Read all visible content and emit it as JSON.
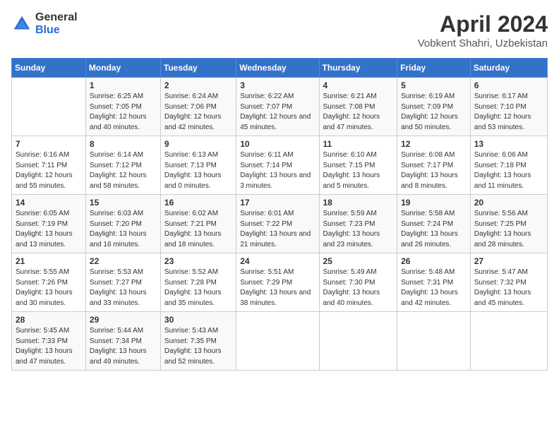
{
  "logo": {
    "general": "General",
    "blue": "Blue"
  },
  "title": "April 2024",
  "location": "Vobkent Shahri, Uzbekistan",
  "weekdays": [
    "Sunday",
    "Monday",
    "Tuesday",
    "Wednesday",
    "Thursday",
    "Friday",
    "Saturday"
  ],
  "weeks": [
    [
      {
        "day": "",
        "sunrise": "",
        "sunset": "",
        "daylight": ""
      },
      {
        "day": "1",
        "sunrise": "Sunrise: 6:25 AM",
        "sunset": "Sunset: 7:05 PM",
        "daylight": "Daylight: 12 hours and 40 minutes."
      },
      {
        "day": "2",
        "sunrise": "Sunrise: 6:24 AM",
        "sunset": "Sunset: 7:06 PM",
        "daylight": "Daylight: 12 hours and 42 minutes."
      },
      {
        "day": "3",
        "sunrise": "Sunrise: 6:22 AM",
        "sunset": "Sunset: 7:07 PM",
        "daylight": "Daylight: 12 hours and 45 minutes."
      },
      {
        "day": "4",
        "sunrise": "Sunrise: 6:21 AM",
        "sunset": "Sunset: 7:08 PM",
        "daylight": "Daylight: 12 hours and 47 minutes."
      },
      {
        "day": "5",
        "sunrise": "Sunrise: 6:19 AM",
        "sunset": "Sunset: 7:09 PM",
        "daylight": "Daylight: 12 hours and 50 minutes."
      },
      {
        "day": "6",
        "sunrise": "Sunrise: 6:17 AM",
        "sunset": "Sunset: 7:10 PM",
        "daylight": "Daylight: 12 hours and 53 minutes."
      }
    ],
    [
      {
        "day": "7",
        "sunrise": "Sunrise: 6:16 AM",
        "sunset": "Sunset: 7:11 PM",
        "daylight": "Daylight: 12 hours and 55 minutes."
      },
      {
        "day": "8",
        "sunrise": "Sunrise: 6:14 AM",
        "sunset": "Sunset: 7:12 PM",
        "daylight": "Daylight: 12 hours and 58 minutes."
      },
      {
        "day": "9",
        "sunrise": "Sunrise: 6:13 AM",
        "sunset": "Sunset: 7:13 PM",
        "daylight": "Daylight: 13 hours and 0 minutes."
      },
      {
        "day": "10",
        "sunrise": "Sunrise: 6:11 AM",
        "sunset": "Sunset: 7:14 PM",
        "daylight": "Daylight: 13 hours and 3 minutes."
      },
      {
        "day": "11",
        "sunrise": "Sunrise: 6:10 AM",
        "sunset": "Sunset: 7:15 PM",
        "daylight": "Daylight: 13 hours and 5 minutes."
      },
      {
        "day": "12",
        "sunrise": "Sunrise: 6:08 AM",
        "sunset": "Sunset: 7:17 PM",
        "daylight": "Daylight: 13 hours and 8 minutes."
      },
      {
        "day": "13",
        "sunrise": "Sunrise: 6:06 AM",
        "sunset": "Sunset: 7:18 PM",
        "daylight": "Daylight: 13 hours and 11 minutes."
      }
    ],
    [
      {
        "day": "14",
        "sunrise": "Sunrise: 6:05 AM",
        "sunset": "Sunset: 7:19 PM",
        "daylight": "Daylight: 13 hours and 13 minutes."
      },
      {
        "day": "15",
        "sunrise": "Sunrise: 6:03 AM",
        "sunset": "Sunset: 7:20 PM",
        "daylight": "Daylight: 13 hours and 16 minutes."
      },
      {
        "day": "16",
        "sunrise": "Sunrise: 6:02 AM",
        "sunset": "Sunset: 7:21 PM",
        "daylight": "Daylight: 13 hours and 18 minutes."
      },
      {
        "day": "17",
        "sunrise": "Sunrise: 6:01 AM",
        "sunset": "Sunset: 7:22 PM",
        "daylight": "Daylight: 13 hours and 21 minutes."
      },
      {
        "day": "18",
        "sunrise": "Sunrise: 5:59 AM",
        "sunset": "Sunset: 7:23 PM",
        "daylight": "Daylight: 13 hours and 23 minutes."
      },
      {
        "day": "19",
        "sunrise": "Sunrise: 5:58 AM",
        "sunset": "Sunset: 7:24 PM",
        "daylight": "Daylight: 13 hours and 26 minutes."
      },
      {
        "day": "20",
        "sunrise": "Sunrise: 5:56 AM",
        "sunset": "Sunset: 7:25 PM",
        "daylight": "Daylight: 13 hours and 28 minutes."
      }
    ],
    [
      {
        "day": "21",
        "sunrise": "Sunrise: 5:55 AM",
        "sunset": "Sunset: 7:26 PM",
        "daylight": "Daylight: 13 hours and 30 minutes."
      },
      {
        "day": "22",
        "sunrise": "Sunrise: 5:53 AM",
        "sunset": "Sunset: 7:27 PM",
        "daylight": "Daylight: 13 hours and 33 minutes."
      },
      {
        "day": "23",
        "sunrise": "Sunrise: 5:52 AM",
        "sunset": "Sunset: 7:28 PM",
        "daylight": "Daylight: 13 hours and 35 minutes."
      },
      {
        "day": "24",
        "sunrise": "Sunrise: 5:51 AM",
        "sunset": "Sunset: 7:29 PM",
        "daylight": "Daylight: 13 hours and 38 minutes."
      },
      {
        "day": "25",
        "sunrise": "Sunrise: 5:49 AM",
        "sunset": "Sunset: 7:30 PM",
        "daylight": "Daylight: 13 hours and 40 minutes."
      },
      {
        "day": "26",
        "sunrise": "Sunrise: 5:48 AM",
        "sunset": "Sunset: 7:31 PM",
        "daylight": "Daylight: 13 hours and 42 minutes."
      },
      {
        "day": "27",
        "sunrise": "Sunrise: 5:47 AM",
        "sunset": "Sunset: 7:32 PM",
        "daylight": "Daylight: 13 hours and 45 minutes."
      }
    ],
    [
      {
        "day": "28",
        "sunrise": "Sunrise: 5:45 AM",
        "sunset": "Sunset: 7:33 PM",
        "daylight": "Daylight: 13 hours and 47 minutes."
      },
      {
        "day": "29",
        "sunrise": "Sunrise: 5:44 AM",
        "sunset": "Sunset: 7:34 PM",
        "daylight": "Daylight: 13 hours and 49 minutes."
      },
      {
        "day": "30",
        "sunrise": "Sunrise: 5:43 AM",
        "sunset": "Sunset: 7:35 PM",
        "daylight": "Daylight: 13 hours and 52 minutes."
      },
      {
        "day": "",
        "sunrise": "",
        "sunset": "",
        "daylight": ""
      },
      {
        "day": "",
        "sunrise": "",
        "sunset": "",
        "daylight": ""
      },
      {
        "day": "",
        "sunrise": "",
        "sunset": "",
        "daylight": ""
      },
      {
        "day": "",
        "sunrise": "",
        "sunset": "",
        "daylight": ""
      }
    ]
  ]
}
